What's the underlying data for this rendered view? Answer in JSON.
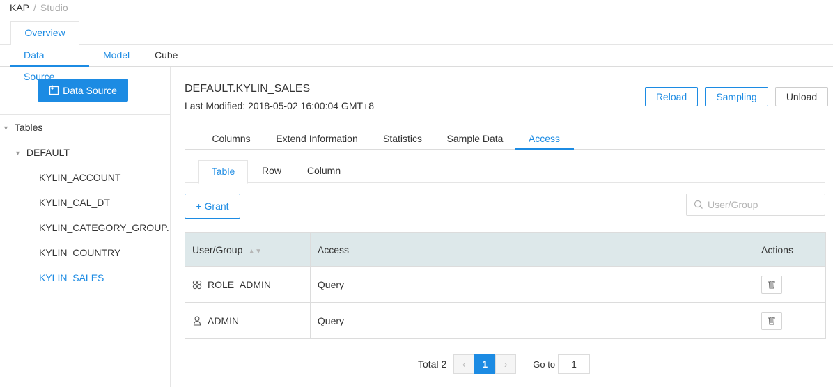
{
  "breadcrumb": {
    "root": "KAP",
    "separator": "/",
    "current": "Studio"
  },
  "top_tab": {
    "label": "Overview"
  },
  "sub_tabs": {
    "data_source": "Data Source",
    "model": "Model",
    "cube": "Cube"
  },
  "sidebar": {
    "add_button_label": "Data Source",
    "tree": {
      "root_label": "Tables",
      "database_label": "DEFAULT",
      "tables": [
        "KYLIN_ACCOUNT",
        "KYLIN_CAL_DT",
        "KYLIN_CATEGORY_GROUP...",
        "KYLIN_COUNTRY",
        "KYLIN_SALES"
      ],
      "selected": "KYLIN_SALES"
    }
  },
  "detail": {
    "title": "DEFAULT.KYLIN_SALES",
    "last_modified": "Last Modified: 2018-05-02 16:00:04 GMT+8",
    "buttons": {
      "reload": "Reload",
      "sampling": "Sampling",
      "unload": "Unload"
    },
    "tabs": [
      "Columns",
      "Extend Information",
      "Statistics",
      "Sample Data",
      "Access"
    ],
    "active_tab": "Access",
    "access_tabs": [
      "Table",
      "Row",
      "Column"
    ],
    "active_access_tab": "Table"
  },
  "access": {
    "grant_label": "Grant",
    "search_placeholder": "User/Group",
    "columns": {
      "user_group": "User/Group",
      "access": "Access",
      "actions": "Actions"
    },
    "rows": [
      {
        "type": "group",
        "name": "ROLE_ADMIN",
        "access": "Query"
      },
      {
        "type": "user",
        "name": "ADMIN",
        "access": "Query"
      }
    ]
  },
  "pagination": {
    "total": "Total 2",
    "current_page": "1",
    "goto_label": "Go to",
    "goto_value": "1"
  },
  "colors": {
    "accent": "#1c8be3",
    "header_bg": "#dde8ea"
  }
}
